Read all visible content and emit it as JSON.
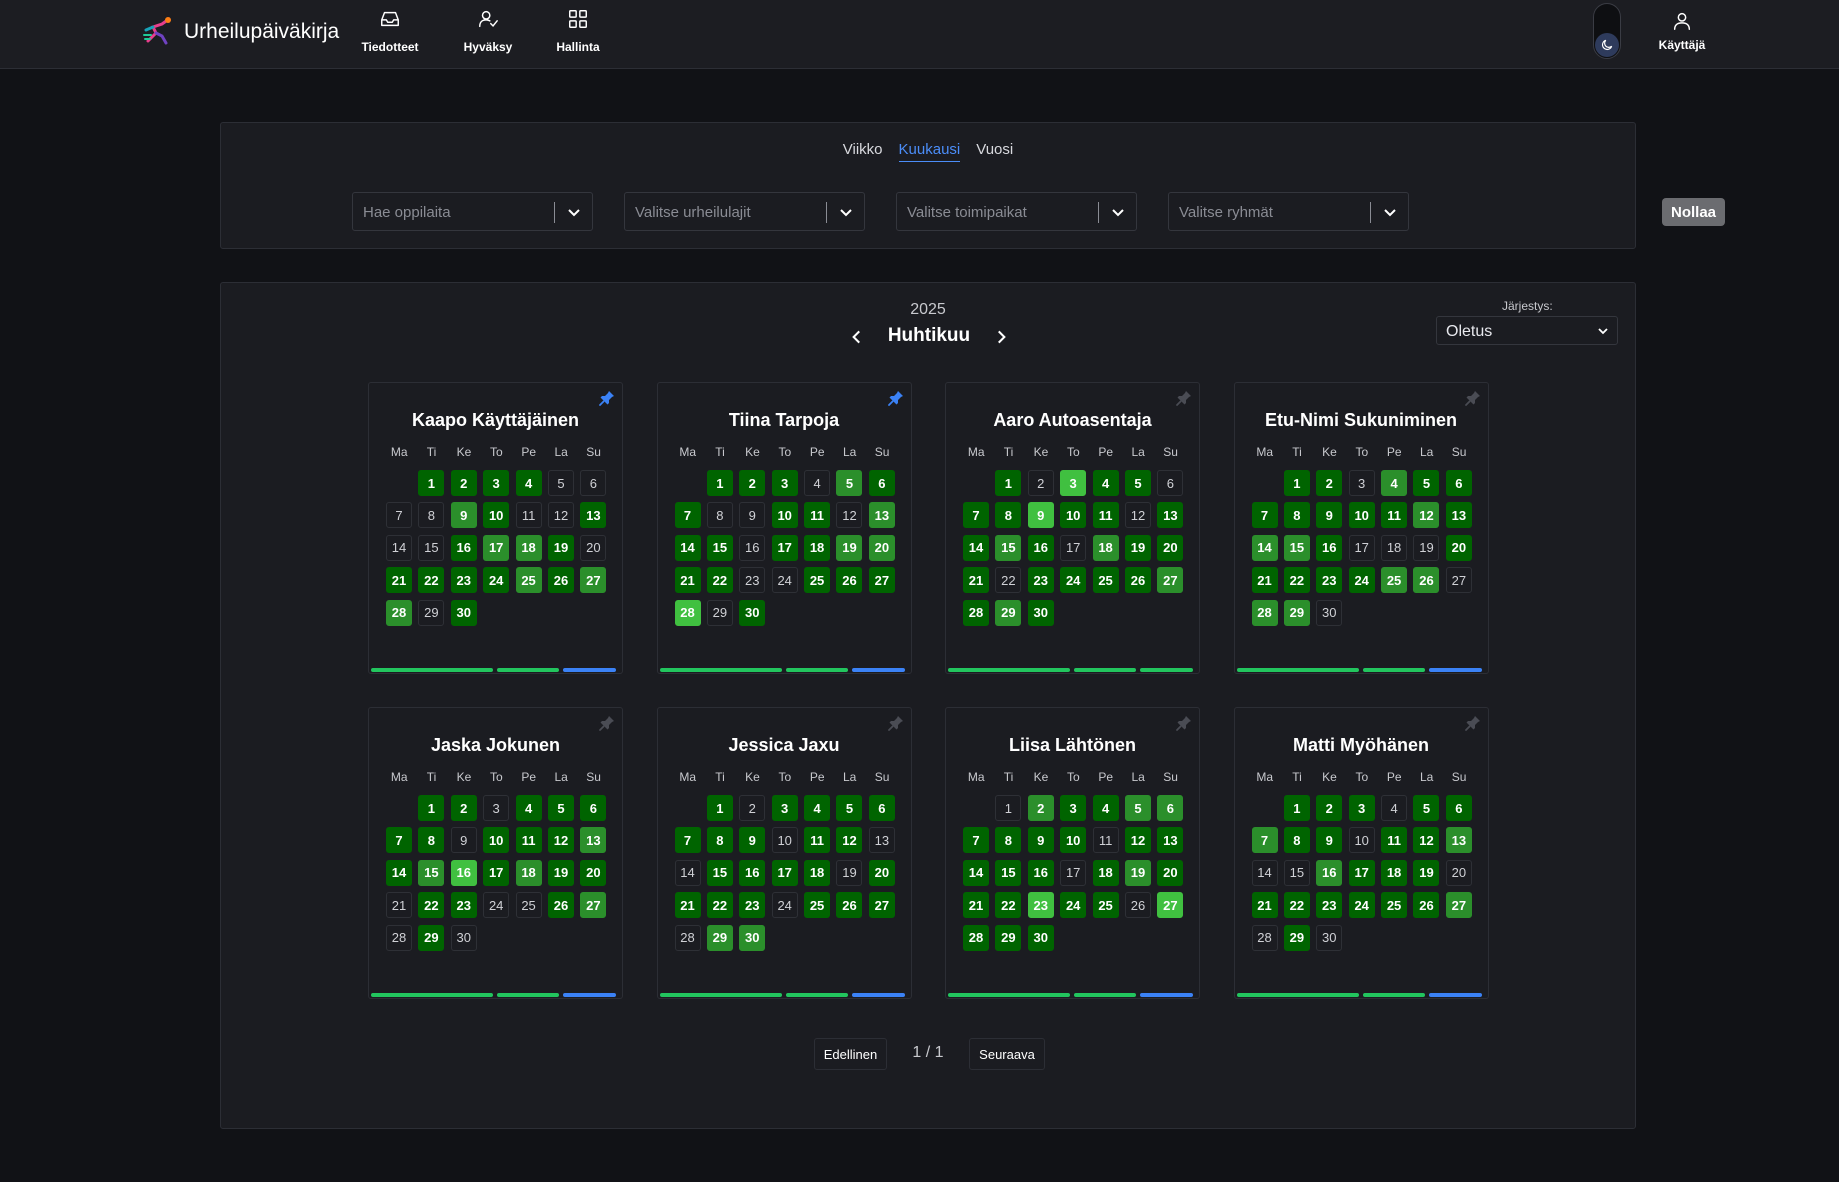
{
  "navbar": {
    "brand": "Urheilupäiväkirja",
    "items": [
      {
        "label": "Tiedotteet",
        "icon": "inbox-icon"
      },
      {
        "label": "Hyväksy",
        "icon": "user-check-icon"
      },
      {
        "label": "Hallinta",
        "icon": "grid-icon"
      }
    ],
    "user_label": "Käyttäjä"
  },
  "filters": {
    "tabs": [
      "Viikko",
      "Kuukausi",
      "Vuosi"
    ],
    "active_tab": "Kuukausi",
    "selects": [
      "Hae oppilaita",
      "Valitse urheilulajit",
      "Valitse toimipaikat",
      "Valitse ryhmät"
    ],
    "reset_label": "Nollaa"
  },
  "calendar": {
    "year": "2025",
    "month": "Huhtikuu",
    "sort_label": "Järjestys:",
    "sort_value": "Oletus",
    "weekdays": [
      "Ma",
      "Ti",
      "Ke",
      "To",
      "Pe",
      "La",
      "Su"
    ],
    "first_day_offset": 1,
    "days_in_month": 30,
    "activity_colors": {
      "1": "#006400",
      "2": "#2b8f2b",
      "3": "#40c040"
    },
    "students": [
      {
        "name": "Kaapo Käyttäjäinen",
        "pinned": true,
        "levels": [
          1,
          1,
          1,
          1,
          0,
          0,
          0,
          0,
          2,
          1,
          0,
          0,
          1,
          0,
          0,
          1,
          2,
          2,
          1,
          0,
          1,
          1,
          1,
          1,
          2,
          1,
          2,
          2,
          0,
          1
        ],
        "bars": [
          "#22c55e",
          "#22c55e",
          "#3b82f6"
        ]
      },
      {
        "name": "Tiina Tarpoja",
        "pinned": true,
        "levels": [
          1,
          1,
          1,
          0,
          2,
          1,
          1,
          0,
          0,
          1,
          1,
          0,
          2,
          1,
          1,
          0,
          1,
          1,
          2,
          2,
          1,
          1,
          0,
          0,
          1,
          1,
          1,
          3,
          0,
          1
        ],
        "bars": [
          "#22c55e",
          "#22c55e",
          "#3b82f6"
        ]
      },
      {
        "name": "Aaro Autoasentaja",
        "pinned": false,
        "levels": [
          1,
          0,
          3,
          1,
          1,
          0,
          1,
          1,
          3,
          1,
          1,
          0,
          1,
          1,
          2,
          1,
          0,
          2,
          1,
          1,
          1,
          0,
          1,
          1,
          1,
          1,
          2,
          1,
          2,
          1
        ],
        "bars": [
          "#22c55e",
          "#22c55e",
          "#22c55e"
        ]
      },
      {
        "name": "Etu-Nimi Sukuniminen",
        "pinned": false,
        "levels": [
          1,
          1,
          0,
          2,
          1,
          1,
          1,
          1,
          1,
          1,
          1,
          2,
          1,
          2,
          2,
          1,
          0,
          0,
          0,
          1,
          1,
          1,
          1,
          1,
          2,
          2,
          0,
          2,
          2,
          0
        ],
        "bars": [
          "#22c55e",
          "#22c55e",
          "#3b82f6"
        ]
      },
      {
        "name": "Jaska Jokunen",
        "pinned": false,
        "levels": [
          1,
          1,
          0,
          1,
          1,
          1,
          1,
          1,
          0,
          1,
          1,
          1,
          2,
          1,
          2,
          3,
          1,
          2,
          1,
          1,
          0,
          1,
          1,
          0,
          0,
          1,
          2,
          0,
          1,
          0
        ],
        "bars": [
          "#22c55e",
          "#22c55e",
          "#3b82f6"
        ]
      },
      {
        "name": "Jessica Jaxu",
        "pinned": false,
        "levels": [
          1,
          0,
          1,
          1,
          1,
          1,
          1,
          1,
          1,
          0,
          1,
          1,
          0,
          0,
          1,
          1,
          1,
          1,
          0,
          1,
          1,
          1,
          1,
          0,
          1,
          1,
          1,
          0,
          2,
          2
        ],
        "bars": [
          "#22c55e",
          "#22c55e",
          "#3b82f6"
        ]
      },
      {
        "name": "Liisa Lähtönen",
        "pinned": false,
        "levels": [
          0,
          2,
          1,
          1,
          2,
          2,
          1,
          1,
          1,
          1,
          0,
          1,
          1,
          1,
          1,
          1,
          0,
          1,
          2,
          1,
          1,
          1,
          3,
          1,
          1,
          0,
          3,
          1,
          1,
          1
        ],
        "bars": [
          "#22c55e",
          "#22c55e",
          "#3b82f6"
        ]
      },
      {
        "name": "Matti Myöhänen",
        "pinned": false,
        "levels": [
          1,
          1,
          1,
          0,
          1,
          1,
          2,
          1,
          1,
          0,
          1,
          1,
          2,
          0,
          0,
          2,
          1,
          1,
          1,
          0,
          1,
          1,
          1,
          1,
          1,
          1,
          2,
          0,
          1,
          0
        ],
        "bars": [
          "#22c55e",
          "#22c55e",
          "#3b82f6"
        ]
      }
    ]
  },
  "pagination": {
    "prev_label": "Edellinen",
    "info": "1 / 1",
    "next_label": "Seuraava"
  }
}
